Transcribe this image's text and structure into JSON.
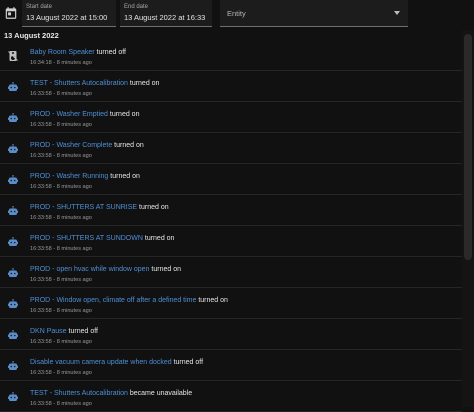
{
  "filters": {
    "start_label": "Start date",
    "start_value": "13 August 2022 at 15:00",
    "end_label": "End date",
    "end_value": "13 August 2022 at 16:33",
    "entity_placeholder": "Entity"
  },
  "date_header": "13 August 2022",
  "entries": [
    {
      "icon": "speaker-icon",
      "entity": "Baby Room Speaker",
      "action": "turned off",
      "time": "16:34:18 - 8 minutes ago"
    },
    {
      "icon": "robot-icon",
      "entity": "TEST - Shutters Autocalibration",
      "action": "turned on",
      "time": "16:33:58 - 8 minutes ago"
    },
    {
      "icon": "robot-icon",
      "entity": "PROD - Washer Emptied",
      "action": "turned on",
      "time": "16:33:58 - 8 minutes ago"
    },
    {
      "icon": "robot-icon",
      "entity": "PROD - Washer Complete",
      "action": "turned on",
      "time": "16:33:58 - 8 minutes ago"
    },
    {
      "icon": "robot-icon",
      "entity": "PROD - Washer Running",
      "action": "turned on",
      "time": "16:33:58 - 8 minutes ago"
    },
    {
      "icon": "robot-icon",
      "entity": "PROD - SHUTTERS AT SUNRISE",
      "action": "turned on",
      "time": "16:33:58 - 8 minutes ago"
    },
    {
      "icon": "robot-icon",
      "entity": "PROD - SHUTTERS AT SUNDOWN",
      "action": "turned on",
      "time": "16:33:58 - 8 minutes ago"
    },
    {
      "icon": "robot-icon",
      "entity": "PROD - open hvac while window open",
      "action": "turned on",
      "time": "16:33:58 - 8 minutes ago"
    },
    {
      "icon": "robot-icon",
      "entity": "PROD - Window open, climate off after a defined time",
      "action": "turned on",
      "time": "16:33:58 - 8 minutes ago"
    },
    {
      "icon": "robot-icon",
      "entity": "DKN Pause",
      "action": "turned off",
      "time": "16:33:58 - 8 minutes ago"
    },
    {
      "icon": "robot-icon",
      "entity": "Disable vacuum camera update when docked",
      "action": "turned off",
      "time": "16:33:58 - 8 minutes ago"
    },
    {
      "icon": "robot-icon",
      "entity": "TEST - Shutters Autocalibration",
      "action": "became unavailable",
      "time": "16:33:58 - 8 minutes ago"
    }
  ]
}
